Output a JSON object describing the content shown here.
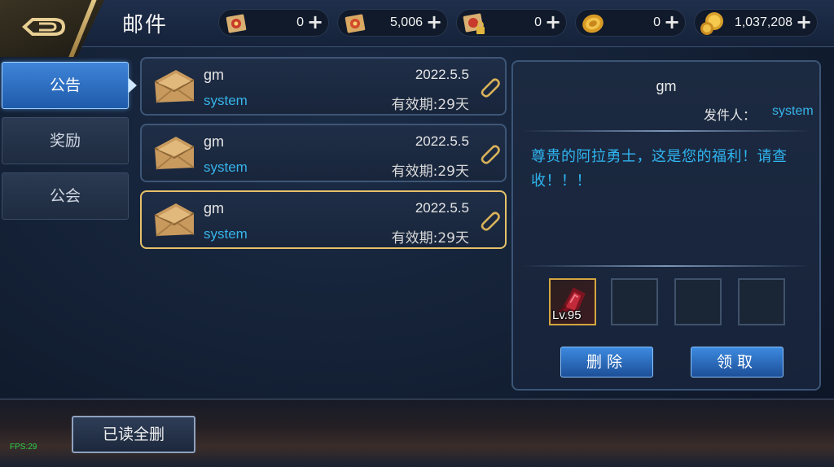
{
  "header": {
    "title": "邮件",
    "currencies": [
      {
        "icon": "scroll-red-icon",
        "amount": "0"
      },
      {
        "icon": "scroll-orange-icon",
        "amount": "5,006"
      },
      {
        "icon": "scroll-locked-icon",
        "amount": "0"
      },
      {
        "icon": "gold-coin-icon",
        "amount": "0"
      },
      {
        "icon": "gold-coins-stack-icon",
        "amount": "1,037,208"
      }
    ],
    "plus_label": "+"
  },
  "tabs": [
    {
      "label": "公告",
      "active": true
    },
    {
      "label": "奖励",
      "active": false
    },
    {
      "label": "公会",
      "active": false
    }
  ],
  "mails": [
    {
      "sender": "gm",
      "subtitle": "system",
      "date": "2022.5.5",
      "expiry": "有效期:29天",
      "selected": false
    },
    {
      "sender": "gm",
      "subtitle": "system",
      "date": "2022.5.5",
      "expiry": "有效期:29天",
      "selected": false
    },
    {
      "sender": "gm",
      "subtitle": "system",
      "date": "2022.5.5",
      "expiry": "有效期:29天",
      "selected": true
    }
  ],
  "detail": {
    "sender": "gm",
    "from_label": "发件人：",
    "from_value": "system",
    "body": "尊贵的阿拉勇士，这是您的福利！请查收！！！",
    "attachments": [
      {
        "filled": true,
        "level": "Lv.95",
        "icon": "crimson-gem-icon"
      },
      {
        "filled": false
      },
      {
        "filled": false
      },
      {
        "filled": false
      }
    ],
    "delete_label": "删除",
    "claim_label": "领取"
  },
  "footer": {
    "delete_read_label": "已读全删",
    "fps": "FPS:29"
  },
  "colors": {
    "accent_blue": "#36b4ea",
    "gold_border": "#e6c16a",
    "button_blue": "#2a6cc0"
  }
}
